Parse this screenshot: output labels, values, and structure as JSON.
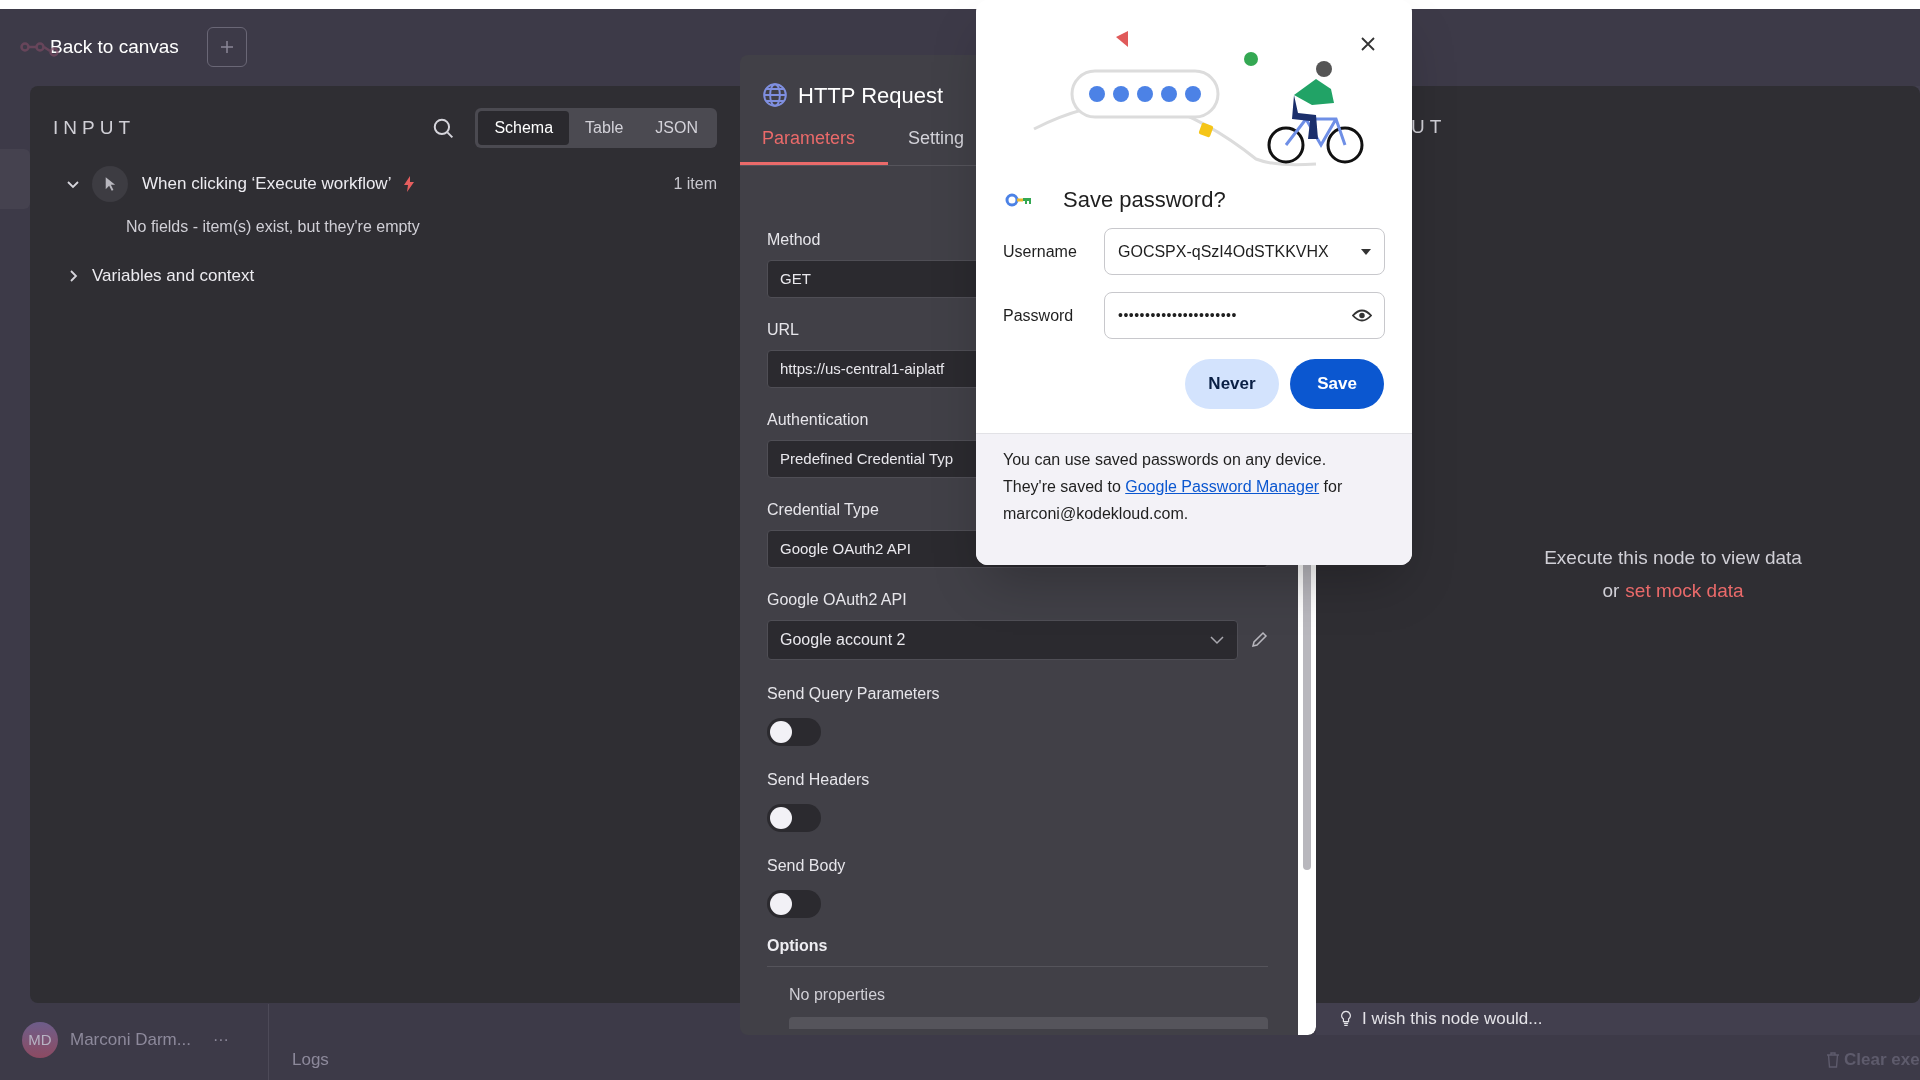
{
  "top_bar": {
    "back_label": "Back to canvas"
  },
  "input_panel": {
    "title": "INPUT",
    "view_tabs": [
      {
        "label": "Schema",
        "selected": true
      },
      {
        "label": "Table",
        "selected": false
      },
      {
        "label": "JSON",
        "selected": false
      }
    ],
    "trigger": {
      "name": "When clicking ‘Execute workflow’",
      "count": "1 item",
      "expanded": true,
      "message": "No fields - item(s) exist, but they're empty"
    },
    "variables": {
      "label": "Variables and context",
      "expanded": false
    }
  },
  "node_panel": {
    "title": "HTTP Request",
    "tabs": [
      {
        "label": "Parameters",
        "selected": true
      },
      {
        "label": "Setting",
        "selected": false
      }
    ],
    "fields": [
      {
        "kind": "input",
        "label": "Method",
        "value": "GET"
      },
      {
        "kind": "input",
        "label": "URL",
        "value": "https://us-central1-aiplatf"
      },
      {
        "kind": "input",
        "label": "Authentication",
        "value": "Predefined Credential Typ"
      },
      {
        "kind": "input",
        "label": "Credential Type",
        "value": "Google OAuth2 API"
      },
      {
        "kind": "select",
        "label": "Google OAuth2 API",
        "value": "Google account 2"
      },
      {
        "kind": "toggle",
        "label": "Send Query Parameters",
        "on": false
      },
      {
        "kind": "toggle",
        "label": "Send Headers",
        "on": false
      },
      {
        "kind": "toggle",
        "label": "Send Body",
        "on": false
      }
    ],
    "options": {
      "label": "Options",
      "empty_text": "No properties"
    }
  },
  "output_panel": {
    "title": "UT",
    "message": "Execute this node to view data",
    "mock_prefix": "or",
    "mock_link": "set mock data",
    "feedback": {
      "placeholder": "I wish this node would..."
    }
  },
  "bottom": {
    "user": {
      "initials": "MD",
      "name": "Marconi Darm...",
      "more": "···"
    },
    "logs_label": "Logs",
    "clear_label": "Clear exe"
  },
  "dialog": {
    "title": "Save password?",
    "username_label": "Username",
    "username": "GOCSPX-qSzI4OdSTKKVHX",
    "password_label": "Password",
    "password_mask": "••••••••••••••••••••••",
    "buttons": [
      {
        "label": "Never",
        "kind": "secondary"
      },
      {
        "label": "Save",
        "kind": "primary"
      }
    ],
    "footer_before": "You can use saved passwords on any device. They're saved to",
    "footer_link": "Google Password Manager",
    "footer_after": "for marconi@kodekloud.com."
  }
}
